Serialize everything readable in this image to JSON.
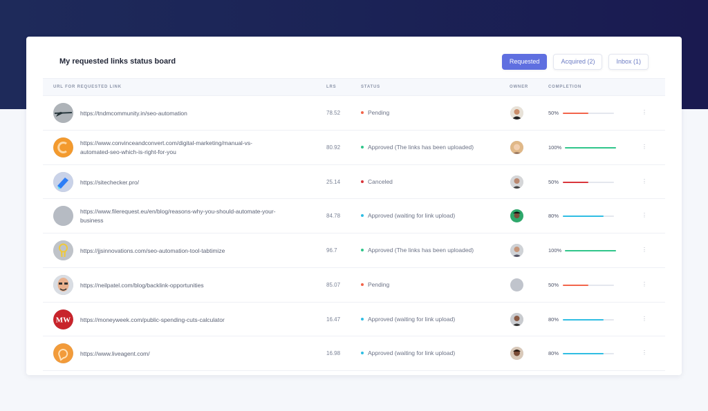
{
  "board": {
    "title": "My requested links status board",
    "tabs": [
      {
        "label": "Requested",
        "active": true
      },
      {
        "label": "Acquired (2)",
        "active": false
      },
      {
        "label": "Inbox (1)",
        "active": false
      }
    ]
  },
  "table": {
    "headers": {
      "url": "URL FOR REQUESTED LINK",
      "lrs": "LRS",
      "status": "STATUS",
      "owner": "OWNER",
      "completion": "COMPLETION"
    },
    "rows": [
      {
        "url_line1": "https://tndmcommunity.in/seo-automation",
        "url_line2": "",
        "lrs": "78.52",
        "status": "Pending",
        "status_color": "#f2644a",
        "completion": "50%",
        "fraction": 0.5,
        "bar_color": "#f2644a",
        "site_icon": "tndm-logo-icon",
        "owner": "owner-avatar-1"
      },
      {
        "url_line1": "https://www.convinceandconvert.com/digital-marketing/manual-vs-",
        "url_line2": "automated-seo-which-is-right-for-you",
        "lrs": "80.92",
        "status": "Approved (The links has been uploaded)",
        "status_color": "#2fc58a",
        "completion": "100%",
        "fraction": 1.0,
        "bar_color": "#2fc58a",
        "site_icon": "convince-logo-icon",
        "owner": "owner-avatar-2"
      },
      {
        "url_line1": "https://sitechecker.pro/",
        "url_line2": "",
        "lrs": "25.14",
        "status": "Canceled",
        "status_color": "#d9353b",
        "completion": "50%",
        "fraction": 0.5,
        "bar_color": "#d9353b",
        "site_icon": "sitechecker-logo-icon",
        "owner": "owner-avatar-3"
      },
      {
        "url_line1": "https://www.filerequest.eu/en/blog/reasons-why-you-should-automate-your-",
        "url_line2": "business",
        "lrs": "84.78",
        "status": "Approved (waiting for link upload)",
        "status_color": "#2fbde3",
        "completion": "80%",
        "fraction": 0.8,
        "bar_color": "#2fbde3",
        "site_icon": "filerequest-logo-icon",
        "owner": "owner-avatar-4"
      },
      {
        "url_line1": "https://jjsinnovations.com/seo-automation-tool-tabtimize",
        "url_line2": "",
        "lrs": "96.7",
        "status": "Approved (The links has been uploaded)",
        "status_color": "#2fc58a",
        "completion": "100%",
        "fraction": 1.0,
        "bar_color": "#2fc58a",
        "site_icon": "jjs-bulb-logo-icon",
        "owner": "owner-avatar-5"
      },
      {
        "url_line1": "https://neilpatel.com/blog/backlink-opportunities",
        "url_line2": "",
        "lrs": "85.07",
        "status": "Pending",
        "status_color": "#f2644a",
        "completion": "50%",
        "fraction": 0.5,
        "bar_color": "#f2644a",
        "site_icon": "neilpatel-logo-icon",
        "owner": "owner-avatar-empty"
      },
      {
        "url_line1": "https://moneyweek.com/public-spending-cuts-calculator",
        "url_line2": "",
        "lrs": "16.47",
        "status": "Approved (waiting for link upload)",
        "status_color": "#2fbde3",
        "completion": "80%",
        "fraction": 0.8,
        "bar_color": "#2fbde3",
        "site_icon": "moneyweek-logo-icon",
        "owner": "owner-avatar-6"
      },
      {
        "url_line1": "https://www.liveagent.com/",
        "url_line2": "",
        "lrs": "16.98",
        "status": "Approved (waiting for link upload)",
        "status_color": "#2fbde3",
        "completion": "80%",
        "fraction": 0.8,
        "bar_color": "#2fbde3",
        "site_icon": "liveagent-logo-icon",
        "owner": "owner-avatar-7"
      }
    ]
  },
  "row_menu_glyph": "⋮"
}
